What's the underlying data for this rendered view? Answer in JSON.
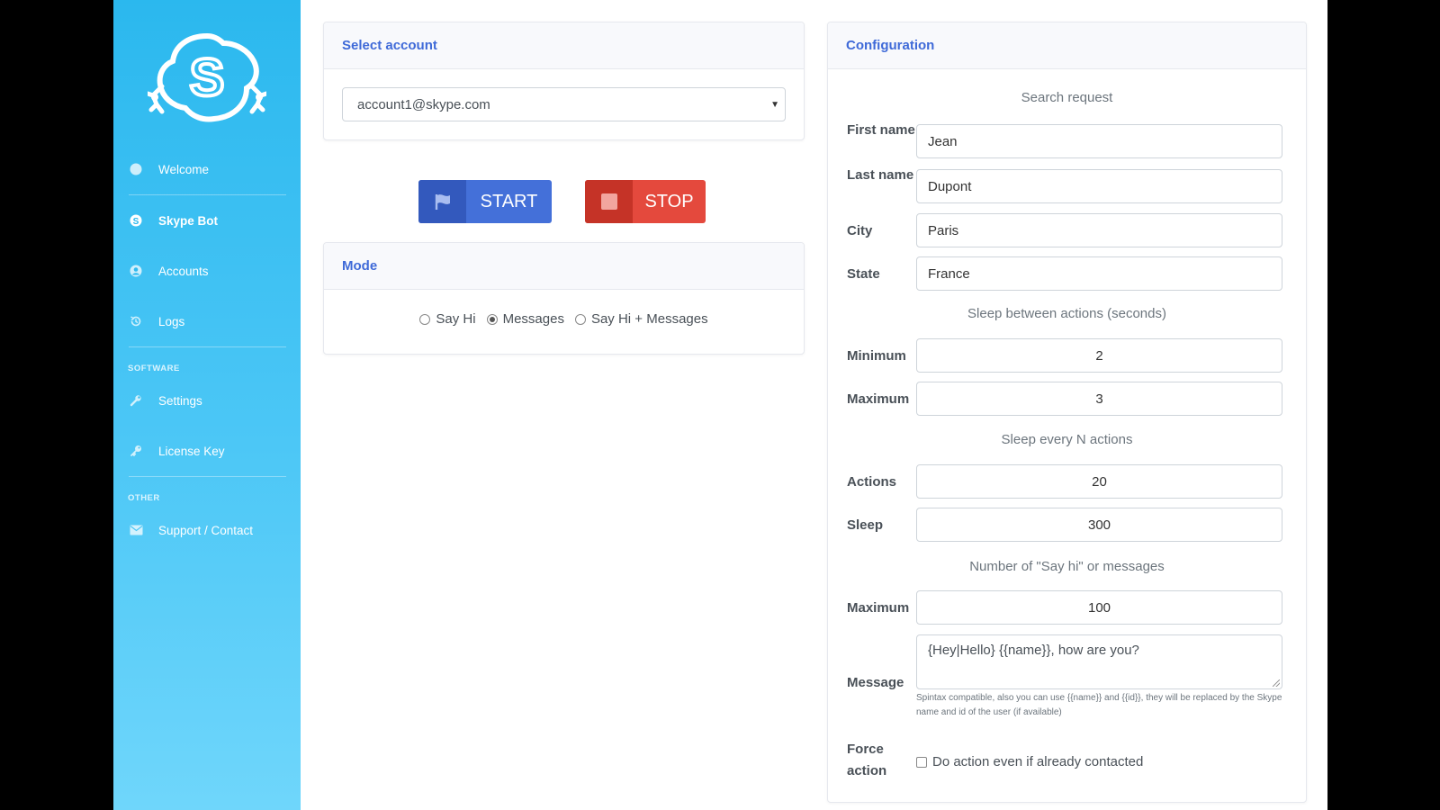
{
  "sidebar": {
    "items": [
      {
        "label": "Welcome",
        "icon": "circle-icon"
      },
      {
        "label": "Skype Bot",
        "icon": "skype-icon"
      },
      {
        "label": "Accounts",
        "icon": "user-icon"
      },
      {
        "label": "Logs",
        "icon": "history-icon"
      },
      {
        "label": "Settings",
        "icon": "wrench-icon"
      },
      {
        "label": "License Key",
        "icon": "key-icon"
      },
      {
        "label": "Support / Contact",
        "icon": "envelope-icon"
      }
    ],
    "sections": {
      "software": "SOFTWARE",
      "other": "OTHER"
    }
  },
  "select_account": {
    "title": "Select account",
    "selected": "account1@skype.com"
  },
  "buttons": {
    "start": "START",
    "stop": "STOP"
  },
  "mode": {
    "title": "Mode",
    "options": [
      "Say Hi",
      "Messages",
      "Say Hi + Messages"
    ],
    "selected": "Messages"
  },
  "config": {
    "title": "Configuration",
    "search_title": "Search request",
    "first_name_label": "First name",
    "first_name": "Jean",
    "last_name_label": "Last name",
    "last_name": "Dupont",
    "city_label": "City",
    "city": "Paris",
    "state_label": "State",
    "state": "France",
    "sleep_title": "Sleep between actions (seconds)",
    "minimum_label": "Minimum",
    "minimum": "2",
    "maximum_label": "Maximum",
    "maximum": "3",
    "every_title": "Sleep every N actions",
    "actions_label": "Actions",
    "actions": "20",
    "sleep_label": "Sleep",
    "sleep": "300",
    "count_title": "Number of \"Say hi\" or messages",
    "count_max_label": "Maximum",
    "count_max": "100",
    "message_label": "Message",
    "message": "{Hey|Hello} {{name}}, how are you?",
    "message_help": "Spintax compatible, also you can use {{name}} and {{id}}, they will be replaced by the Skype name and id of the user (if available)",
    "force_label": "Force action",
    "force_checkbox": "Do action even if already contacted"
  },
  "colors": {
    "accent": "#3f6ad8",
    "start": "#4470d9",
    "stop": "#e4493d",
    "sidebar": "#2bb8ee"
  }
}
